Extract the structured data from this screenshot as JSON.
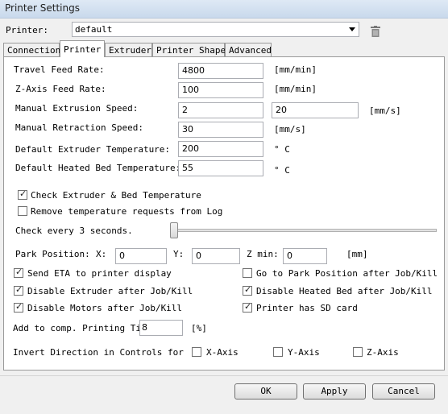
{
  "window": {
    "title": "Printer Settings"
  },
  "printer": {
    "label": "Printer:",
    "selected": "default"
  },
  "tabs": [
    "Connection",
    "Printer",
    "Extruder",
    "Printer Shape",
    "Advanced"
  ],
  "fields": {
    "travel_feed_rate": {
      "label": "Travel Feed Rate:",
      "value": "4800",
      "unit": "[mm/min]"
    },
    "z_axis_feed_rate": {
      "label": "Z-Axis Feed Rate:",
      "value": "100",
      "unit": "[mm/min]"
    },
    "manual_extrusion_speed": {
      "label": "Manual Extrusion Speed:",
      "value": "2",
      "value2": "20",
      "unit": "[mm/s]"
    },
    "manual_retraction_speed": {
      "label": "Manual Retraction Speed:",
      "value": "30",
      "unit": "[mm/s]"
    },
    "default_extruder_temp": {
      "label": "Default Extruder Temperature:",
      "value": "200",
      "unit": "° C"
    },
    "default_bed_temp": {
      "label": "Default Heated Bed Temperature:",
      "value": "55",
      "unit": "° C"
    }
  },
  "checks": {
    "check_temperature": {
      "label": "Check Extruder & Bed Temperature",
      "checked": true
    },
    "remove_temp_requests": {
      "label": "Remove temperature requests from Log",
      "checked": false
    }
  },
  "check_every": {
    "label": "Check every 3 seconds.",
    "level": 0.0
  },
  "park": {
    "label": "Park Position:",
    "x_label": "X:",
    "x": "0",
    "y_label": "Y:",
    "y": "0",
    "z_label": "Z min:",
    "z": "0",
    "unit": "[mm]"
  },
  "options": {
    "send_eta": {
      "label": "Send ETA to printer display",
      "checked": true
    },
    "go_to_park": {
      "label": "Go to Park Position after Job/Kill",
      "checked": false
    },
    "disable_extruder": {
      "label": "Disable Extruder after Job/Kill",
      "checked": true
    },
    "disable_heated_bed": {
      "label": "Disable Heated Bed after Job/Kill",
      "checked": true
    },
    "disable_motors": {
      "label": "Disable Motors after Job/Kill",
      "checked": true
    },
    "has_sd_card": {
      "label": "Printer has SD card",
      "checked": true
    }
  },
  "add_time": {
    "label": "Add to comp. Printing Time",
    "value": "8",
    "unit": "[%]"
  },
  "invert": {
    "label": "Invert Direction in Controls for",
    "x": "X-Axis",
    "y": "Y-Axis",
    "z": "Z-Axis"
  },
  "buttons": {
    "ok": "OK",
    "apply": "Apply",
    "cancel": "Cancel"
  },
  "icons": {
    "delete": "trash-icon",
    "dropdown": "chevron-down-icon"
  }
}
